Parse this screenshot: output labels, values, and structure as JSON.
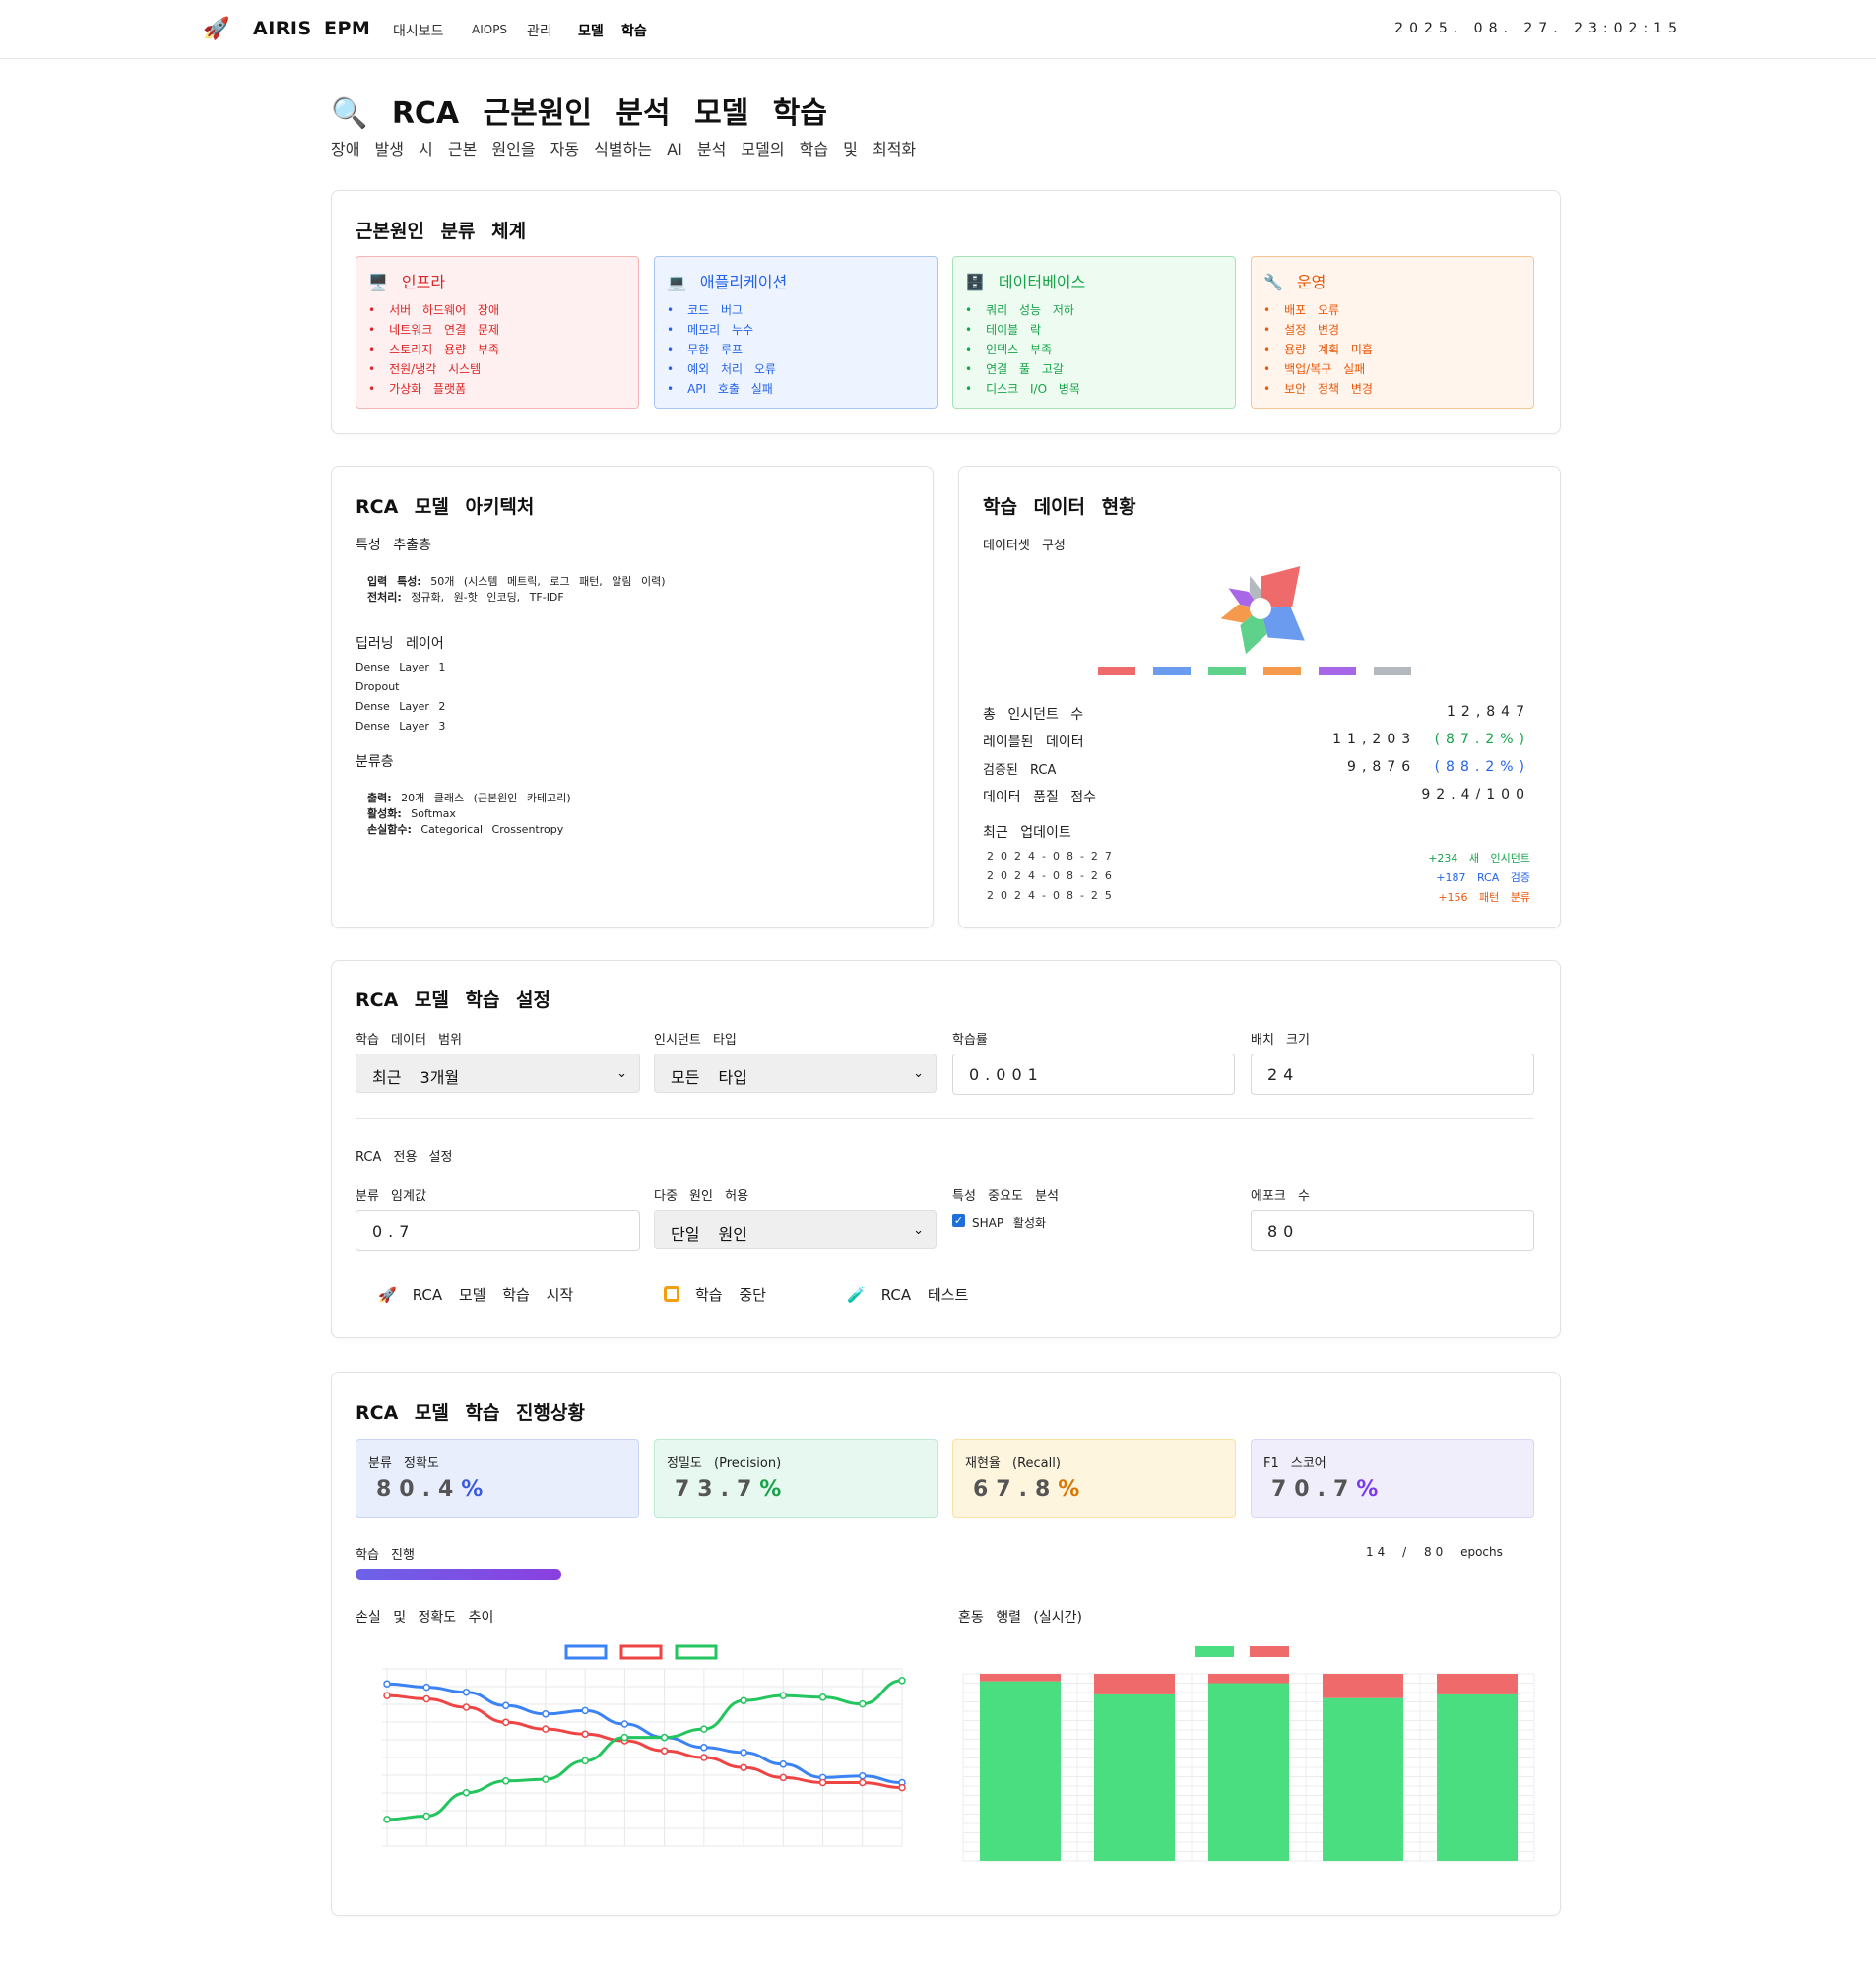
{
  "nav": {
    "brand1": "AIRIS",
    "brand2": "EPM",
    "menu": [
      "대시보드",
      "AIOPS",
      "관리",
      "모델",
      "학습"
    ],
    "clock": "2025. 08. 27. 23:02:15"
  },
  "page": {
    "title": "RCA 근본원인 분석 모델 학습",
    "icon": "🔍",
    "subtitle": "장애 발생 시 근본 원인을 자동 식별하는 AI 분석 모델의 학습 및 최적화"
  },
  "taxonomy": {
    "title": "근본원인 분류 체계",
    "categories": [
      {
        "icon": "🖥️",
        "name": "인프라",
        "color": "#dc2626",
        "bg": "#fef0f0",
        "border": "#f5b5b5",
        "items": [
          "서버 하드웨어 장애",
          "네트워크 연결 문제",
          "스토리지 용량 부족",
          "전원/냉각 시스템",
          "가상화 플랫폼"
        ]
      },
      {
        "icon": "💻",
        "name": "애플리케이션",
        "color": "#2563eb",
        "bg": "#eef4ff",
        "border": "#a9c5f5",
        "items": [
          "코드 버그",
          "메모리 누수",
          "무한 루프",
          "예외 처리 오류",
          "API 호출 실패"
        ]
      },
      {
        "icon": "🗄️",
        "name": "데이터베이스",
        "color": "#16a34a",
        "bg": "#eefbf1",
        "border": "#a6e3b7",
        "items": [
          "쿼리 성능 저하",
          "테이블 락",
          "인덱스 부족",
          "연결 풀 고갈",
          "디스크 I/O 병목"
        ]
      },
      {
        "icon": "🔧",
        "name": "운영",
        "color": "#ea580c",
        "bg": "#fff5ec",
        "border": "#f7c495",
        "items": [
          "배포 오류",
          "설정 변경",
          "용량 계획 미흡",
          "백업/복구 실패",
          "보안 정책 변경"
        ]
      }
    ]
  },
  "architecture": {
    "title": "RCA 모델 아키텍처",
    "feature_title": "특성 추출층",
    "input_label": "입력 특성:",
    "input_value": "50개 (시스템 메트릭, 로그 패턴, 알림 이력)",
    "preproc_label": "전처리:",
    "preproc_value": "정규화, 원-핫 인코딩, TF-IDF",
    "dl_title": "딥러닝 레이어",
    "layers": [
      "Dense Layer 1",
      "Dropout",
      "Dense Layer 2",
      "Dense Layer 3"
    ],
    "cls_title": "분류층",
    "output_label": "출력:",
    "output_value": "20개 클래스 (근본원인 카테고리)",
    "act_label": "활성화:",
    "act_value": "Softmax",
    "loss_label": "손실함수:",
    "loss_value": "Categorical Crossentropy"
  },
  "dataset": {
    "title": "학습 데이터 현황",
    "subtitle": "데이터셋 구성",
    "legend_colors": [
      "#ef6b6b",
      "#6b9bef",
      "#5ed18a",
      "#f59a4c",
      "#a867e6",
      "#b4b8bf"
    ],
    "composition": [
      24,
      22,
      18,
      14,
      12,
      10
    ],
    "stats": [
      {
        "label": "총 인시던트 수",
        "value": "12,847",
        "pct": ""
      },
      {
        "label": "레이블된 데이터",
        "value": "11,203",
        "pct": "(87.2%)"
      },
      {
        "label": "검증된 RCA",
        "value": "9,876",
        "pct": "(88.2%)"
      },
      {
        "label": "데이터 품질 점수",
        "value": "92.4/100",
        "pct": ""
      }
    ],
    "update_title": "최근 업데이트",
    "updates": [
      {
        "date": "2024-08-27",
        "change": "+234 새 인시던트",
        "color": "#16a34a"
      },
      {
        "date": "2024-08-26",
        "change": "+187 RCA 검증",
        "color": "#2563eb"
      },
      {
        "date": "2024-08-25",
        "change": "+156 패턴 분류",
        "color": "#ea580c"
      }
    ]
  },
  "settings": {
    "title": "RCA 모델 학습 설정",
    "range_label": "학습 데이터 범위",
    "range_value": "최근 3개월",
    "type_label": "인시던트 타입",
    "type_value": "모든 타입",
    "lr_label": "학습률",
    "lr_value": "0.001",
    "batch_label": "배치 크기",
    "batch_value": "24",
    "rca_title": "RCA 전용 설정",
    "threshold_label": "분류 임계값",
    "threshold_value": "0.7",
    "multi_label": "다중 원인 허용",
    "multi_value": "단일 원인",
    "feat_label": "특성 중요도 분석",
    "shap_label": "SHAP 활성화",
    "epoch_label": "에포크 수",
    "epoch_value": "80",
    "btn_start": "RCA 모델 학습 시작",
    "btn_stop": "학습 중단",
    "btn_test": "RCA 테스트"
  },
  "progress": {
    "title": "RCA 모델 학습 진행상황",
    "metrics": [
      {
        "label": "분류 정확도",
        "value": "80.4%",
        "bg": "#e9eefd",
        "border": "#c9d5f8",
        "color": "#3b5bdb"
      },
      {
        "label": "정밀도 (Precision)",
        "value": "73.7%",
        "bg": "#e6f8ef",
        "border": "#bdebd0",
        "color": "#16a34a"
      },
      {
        "label": "재현율 (Recall)",
        "value": "67.8%",
        "bg": "#fdf5dd",
        "border": "#f6e2a6",
        "color": "#d97706"
      },
      {
        "label": "F1 스코어",
        "value": "70.7%",
        "bg": "#f1eefc",
        "border": "#ddd4f7",
        "color": "#7c3aed"
      }
    ],
    "progress_label": "학습 진행",
    "epoch_current": "14",
    "epoch_total": "80",
    "epoch_unit": "epochs",
    "progress_fraction": 0.175,
    "loss_chart_title": "손실 및 정확도 추이",
    "confusion_title": "혼동 행렬 (실시간)"
  },
  "chart_data": [
    {
      "type": "line",
      "x": [
        1,
        2,
        3,
        4,
        5,
        6,
        7,
        8,
        9,
        10,
        11,
        12,
        13,
        14
      ],
      "series": [
        {
          "color": "#3b82f6",
          "values": [
            0.94,
            0.92,
            0.89,
            0.81,
            0.76,
            0.78,
            0.7,
            0.62,
            0.56,
            0.53,
            0.46,
            0.38,
            0.39,
            0.35
          ]
        },
        {
          "color": "#ef4444",
          "values": [
            0.87,
            0.85,
            0.8,
            0.71,
            0.67,
            0.64,
            0.6,
            0.54,
            0.5,
            0.44,
            0.38,
            0.35,
            0.35,
            0.32
          ]
        },
        {
          "color": "#22c55e",
          "values": [
            0.13,
            0.15,
            0.29,
            0.36,
            0.37,
            0.48,
            0.62,
            0.62,
            0.67,
            0.84,
            0.87,
            0.86,
            0.82,
            0.96
          ]
        }
      ],
      "ylim": [
        0,
        1
      ],
      "grid": true,
      "legend": "top"
    },
    {
      "type": "bar",
      "stacked": true,
      "categories": [
        "1",
        "2",
        "3",
        "4",
        "5"
      ],
      "series": [
        {
          "color": "#4ade80",
          "values": [
            0.96,
            0.89,
            0.95,
            0.87,
            0.89
          ]
        },
        {
          "color": "#ef6b6b",
          "values": [
            0.04,
            0.11,
            0.05,
            0.13,
            0.11
          ]
        }
      ],
      "ylim": [
        0,
        1
      ],
      "grid": true,
      "legend": "top"
    }
  ]
}
